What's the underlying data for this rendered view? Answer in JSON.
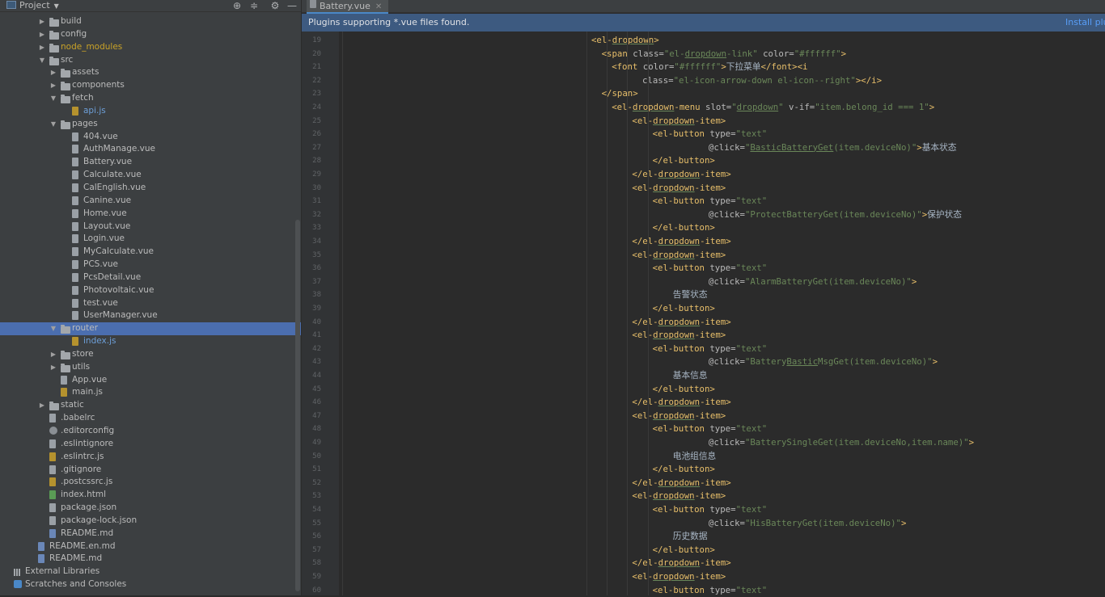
{
  "project_panel": {
    "title": "Project",
    "tree": [
      {
        "label": "build",
        "kind": "folder",
        "depth": 1,
        "expanded": false
      },
      {
        "label": "config",
        "kind": "folder",
        "depth": 1,
        "expanded": false
      },
      {
        "label": "node_modules",
        "kind": "folder",
        "depth": 1,
        "expanded": false,
        "style": "excluded"
      },
      {
        "label": "src",
        "kind": "folder",
        "depth": 1,
        "expanded": true
      },
      {
        "label": "assets",
        "kind": "folder",
        "depth": 2,
        "expanded": false
      },
      {
        "label": "components",
        "kind": "folder",
        "depth": 2,
        "expanded": false
      },
      {
        "label": "fetch",
        "kind": "folder",
        "depth": 2,
        "expanded": true
      },
      {
        "label": "api.js",
        "kind": "js",
        "depth": 3,
        "style": "linked"
      },
      {
        "label": "pages",
        "kind": "folder",
        "depth": 2,
        "expanded": true
      },
      {
        "label": "404.vue",
        "kind": "file",
        "depth": 3
      },
      {
        "label": "AuthManage.vue",
        "kind": "file",
        "depth": 3
      },
      {
        "label": "Battery.vue",
        "kind": "file",
        "depth": 3
      },
      {
        "label": "Calculate.vue",
        "kind": "file",
        "depth": 3
      },
      {
        "label": "CalEnglish.vue",
        "kind": "file",
        "depth": 3
      },
      {
        "label": "Canine.vue",
        "kind": "file",
        "depth": 3
      },
      {
        "label": "Home.vue",
        "kind": "file",
        "depth": 3
      },
      {
        "label": "Layout.vue",
        "kind": "file",
        "depth": 3
      },
      {
        "label": "Login.vue",
        "kind": "file",
        "depth": 3
      },
      {
        "label": "MyCalculate.vue",
        "kind": "file",
        "depth": 3
      },
      {
        "label": "PCS.vue",
        "kind": "file",
        "depth": 3
      },
      {
        "label": "PcsDetail.vue",
        "kind": "file",
        "depth": 3
      },
      {
        "label": "Photovoltaic.vue",
        "kind": "file",
        "depth": 3
      },
      {
        "label": "test.vue",
        "kind": "file",
        "depth": 3
      },
      {
        "label": "UserManager.vue",
        "kind": "file",
        "depth": 3
      },
      {
        "label": "router",
        "kind": "folder",
        "depth": 2,
        "expanded": true,
        "selected": true
      },
      {
        "label": "index.js",
        "kind": "js",
        "depth": 3,
        "style": "linked"
      },
      {
        "label": "store",
        "kind": "folder",
        "depth": 2,
        "expanded": false
      },
      {
        "label": "utils",
        "kind": "folder",
        "depth": 2,
        "expanded": false
      },
      {
        "label": "App.vue",
        "kind": "file",
        "depth": 2
      },
      {
        "label": "main.js",
        "kind": "js",
        "depth": 2
      },
      {
        "label": "static",
        "kind": "folder",
        "depth": 1,
        "expanded": false
      },
      {
        "label": ".babelrc",
        "kind": "file",
        "depth": 1
      },
      {
        "label": ".editorconfig",
        "kind": "cfg",
        "depth": 1
      },
      {
        "label": ".eslintignore",
        "kind": "file",
        "depth": 1
      },
      {
        "label": ".eslintrc.js",
        "kind": "js",
        "depth": 1
      },
      {
        "label": ".gitignore",
        "kind": "file",
        "depth": 1
      },
      {
        "label": ".postcssrc.js",
        "kind": "js",
        "depth": 1
      },
      {
        "label": "index.html",
        "kind": "html",
        "depth": 1
      },
      {
        "label": "package.json",
        "kind": "file",
        "depth": 1
      },
      {
        "label": "package-lock.json",
        "kind": "file",
        "depth": 1
      },
      {
        "label": "README.md",
        "kind": "md",
        "depth": 1
      },
      {
        "label": "README.en.md",
        "kind": "md",
        "depth": 0
      },
      {
        "label": "README.md",
        "kind": "md",
        "depth": 0
      },
      {
        "label": "External Libraries",
        "kind": "lib",
        "depth": -1
      },
      {
        "label": "Scratches and Consoles",
        "kind": "scratch",
        "depth": -1
      }
    ]
  },
  "editor": {
    "tab_label": "Battery.vue",
    "banner_message": "Plugins supporting *.vue files found.",
    "banner_action": "Install plugins",
    "first_line_number": 19,
    "lines": [
      {
        "indent": 0,
        "tokens": [
          [
            "t",
            "<el-"
          ],
          [
            "u",
            "dropdown"
          ],
          [
            "t",
            ">"
          ]
        ]
      },
      {
        "indent": 1,
        "tokens": [
          [
            "t",
            "<span "
          ],
          [
            "a",
            "class="
          ],
          [
            "s",
            "\"el-"
          ],
          [
            "su",
            "dropdown"
          ],
          [
            "s",
            "-link\""
          ],
          [
            "t",
            " "
          ],
          [
            "a",
            "color="
          ],
          [
            "s",
            "\"#ffffff\""
          ],
          [
            "t",
            ">"
          ]
        ]
      },
      {
        "indent": 2,
        "tokens": [
          [
            "t",
            "<font "
          ],
          [
            "a",
            "color="
          ],
          [
            "s",
            "\"#ffffff\""
          ],
          [
            "t",
            ">"
          ],
          [
            "p",
            "下拉菜单"
          ],
          [
            "t",
            "</font><i"
          ]
        ]
      },
      {
        "indent": 5,
        "tokens": [
          [
            "a",
            "class="
          ],
          [
            "s",
            "\"el-icon-arrow-down el-icon--right\""
          ],
          [
            "t",
            "></i>"
          ]
        ]
      },
      {
        "indent": 1,
        "tokens": [
          [
            "t",
            "</span>"
          ]
        ]
      },
      {
        "indent": 2,
        "tokens": [
          [
            "t",
            "<el-"
          ],
          [
            "u",
            "dropdown"
          ],
          [
            "t",
            "-menu "
          ],
          [
            "a",
            "slot="
          ],
          [
            "s",
            "\""
          ],
          [
            "su",
            "dropdown"
          ],
          [
            "s",
            "\""
          ],
          [
            "t",
            " "
          ],
          [
            "a",
            "v-if="
          ],
          [
            "s",
            "\"item.belong_id === 1\""
          ],
          [
            "t",
            ">"
          ]
        ]
      },
      {
        "indent": 4,
        "tokens": [
          [
            "t",
            "<el-"
          ],
          [
            "u",
            "dropdown"
          ],
          [
            "t",
            "-item>"
          ]
        ]
      },
      {
        "indent": 6,
        "tokens": [
          [
            "t",
            "<el-button "
          ],
          [
            "a",
            "type="
          ],
          [
            "s",
            "\"text\""
          ]
        ]
      },
      {
        "indent": 11.5,
        "tokens": [
          [
            "a",
            "@click="
          ],
          [
            "s",
            "\""
          ],
          [
            "su",
            "BasticBatteryGet"
          ],
          [
            "s",
            "(item.deviceNo)\""
          ],
          [
            "t",
            ">"
          ],
          [
            "p",
            "基本状态"
          ]
        ]
      },
      {
        "indent": 6,
        "tokens": [
          [
            "t",
            "</el-button>"
          ]
        ]
      },
      {
        "indent": 4,
        "tokens": [
          [
            "t",
            "</el-"
          ],
          [
            "u",
            "dropdown"
          ],
          [
            "t",
            "-item>"
          ]
        ]
      },
      {
        "indent": 4,
        "tokens": [
          [
            "t",
            "<el-"
          ],
          [
            "u",
            "dropdown"
          ],
          [
            "t",
            "-item>"
          ]
        ]
      },
      {
        "indent": 6,
        "tokens": [
          [
            "t",
            "<el-button "
          ],
          [
            "a",
            "type="
          ],
          [
            "s",
            "\"text\""
          ]
        ]
      },
      {
        "indent": 11.5,
        "tokens": [
          [
            "a",
            "@click="
          ],
          [
            "s",
            "\"ProtectBatteryGet(item.deviceNo)\""
          ],
          [
            "t",
            ">"
          ],
          [
            "p",
            "保护状态"
          ]
        ]
      },
      {
        "indent": 6,
        "tokens": [
          [
            "t",
            "</el-button>"
          ]
        ]
      },
      {
        "indent": 4,
        "tokens": [
          [
            "t",
            "</el-"
          ],
          [
            "u",
            "dropdown"
          ],
          [
            "t",
            "-item>"
          ]
        ]
      },
      {
        "indent": 4,
        "tokens": [
          [
            "t",
            "<el-"
          ],
          [
            "u",
            "dropdown"
          ],
          [
            "t",
            "-item>"
          ]
        ]
      },
      {
        "indent": 6,
        "tokens": [
          [
            "t",
            "<el-button "
          ],
          [
            "a",
            "type="
          ],
          [
            "s",
            "\"text\""
          ]
        ]
      },
      {
        "indent": 11.5,
        "tokens": [
          [
            "a",
            "@click="
          ],
          [
            "s",
            "\"AlarmBatteryGet(item.deviceNo)\""
          ],
          [
            "t",
            ">"
          ]
        ]
      },
      {
        "indent": 8,
        "tokens": [
          [
            "p",
            "告警状态"
          ]
        ]
      },
      {
        "indent": 6,
        "tokens": [
          [
            "t",
            "</el-button>"
          ]
        ]
      },
      {
        "indent": 4,
        "tokens": [
          [
            "t",
            "</el-"
          ],
          [
            "u",
            "dropdown"
          ],
          [
            "t",
            "-item>"
          ]
        ]
      },
      {
        "indent": 4,
        "tokens": [
          [
            "t",
            "<el-"
          ],
          [
            "u",
            "dropdown"
          ],
          [
            "t",
            "-item>"
          ]
        ]
      },
      {
        "indent": 6,
        "tokens": [
          [
            "t",
            "<el-button "
          ],
          [
            "a",
            "type="
          ],
          [
            "s",
            "\"text\""
          ]
        ]
      },
      {
        "indent": 11.5,
        "tokens": [
          [
            "a",
            "@click="
          ],
          [
            "s",
            "\"Battery"
          ],
          [
            "su",
            "Bastic"
          ],
          [
            "s",
            "MsgGet(item.deviceNo)\""
          ],
          [
            "t",
            ">"
          ]
        ]
      },
      {
        "indent": 8,
        "tokens": [
          [
            "p",
            "基本信息"
          ]
        ]
      },
      {
        "indent": 6,
        "tokens": [
          [
            "t",
            "</el-button>"
          ]
        ]
      },
      {
        "indent": 4,
        "tokens": [
          [
            "t",
            "</el-"
          ],
          [
            "u",
            "dropdown"
          ],
          [
            "t",
            "-item>"
          ]
        ]
      },
      {
        "indent": 4,
        "tokens": [
          [
            "t",
            "<el-"
          ],
          [
            "u",
            "dropdown"
          ],
          [
            "t",
            "-item>"
          ]
        ]
      },
      {
        "indent": 6,
        "tokens": [
          [
            "t",
            "<el-button "
          ],
          [
            "a",
            "type="
          ],
          [
            "s",
            "\"text\""
          ]
        ]
      },
      {
        "indent": 11.5,
        "tokens": [
          [
            "a",
            "@click="
          ],
          [
            "s",
            "\"BatterySingleGet(item.deviceNo,item.name)\""
          ],
          [
            "t",
            ">"
          ]
        ]
      },
      {
        "indent": 8,
        "tokens": [
          [
            "p",
            "电池组信息"
          ]
        ]
      },
      {
        "indent": 6,
        "tokens": [
          [
            "t",
            "</el-button>"
          ]
        ]
      },
      {
        "indent": 4,
        "tokens": [
          [
            "t",
            "</el-"
          ],
          [
            "u",
            "dropdown"
          ],
          [
            "t",
            "-item>"
          ]
        ]
      },
      {
        "indent": 4,
        "tokens": [
          [
            "t",
            "<el-"
          ],
          [
            "u",
            "dropdown"
          ],
          [
            "t",
            "-item>"
          ]
        ]
      },
      {
        "indent": 6,
        "tokens": [
          [
            "t",
            "<el-button "
          ],
          [
            "a",
            "type="
          ],
          [
            "s",
            "\"text\""
          ]
        ]
      },
      {
        "indent": 11.5,
        "tokens": [
          [
            "a",
            "@click="
          ],
          [
            "s",
            "\"HisBatteryGet(item.deviceNo)\""
          ],
          [
            "t",
            ">"
          ]
        ]
      },
      {
        "indent": 8,
        "tokens": [
          [
            "p",
            "历史数据"
          ]
        ]
      },
      {
        "indent": 6,
        "tokens": [
          [
            "t",
            "</el-button>"
          ]
        ]
      },
      {
        "indent": 4,
        "tokens": [
          [
            "t",
            "</el-"
          ],
          [
            "u",
            "dropdown"
          ],
          [
            "t",
            "-item>"
          ]
        ]
      },
      {
        "indent": 4,
        "tokens": [
          [
            "t",
            "<el-"
          ],
          [
            "u",
            "dropdown"
          ],
          [
            "t",
            "-item>"
          ]
        ]
      },
      {
        "indent": 6,
        "tokens": [
          [
            "t",
            "<el-button "
          ],
          [
            "a",
            "type="
          ],
          [
            "s",
            "\"text\""
          ]
        ]
      }
    ]
  },
  "colors": {
    "tag": "#e8bf6a",
    "attr": "#bababa",
    "string": "#6a8759",
    "plain_text": "#a9b7c6",
    "selection": "#4b6eaf",
    "banner": "#3d5a80"
  },
  "icons": {
    "locate": "crosshair-icon",
    "collapse": "collapse-all-icon",
    "settings": "gear-icon",
    "hide": "minimize-icon"
  }
}
